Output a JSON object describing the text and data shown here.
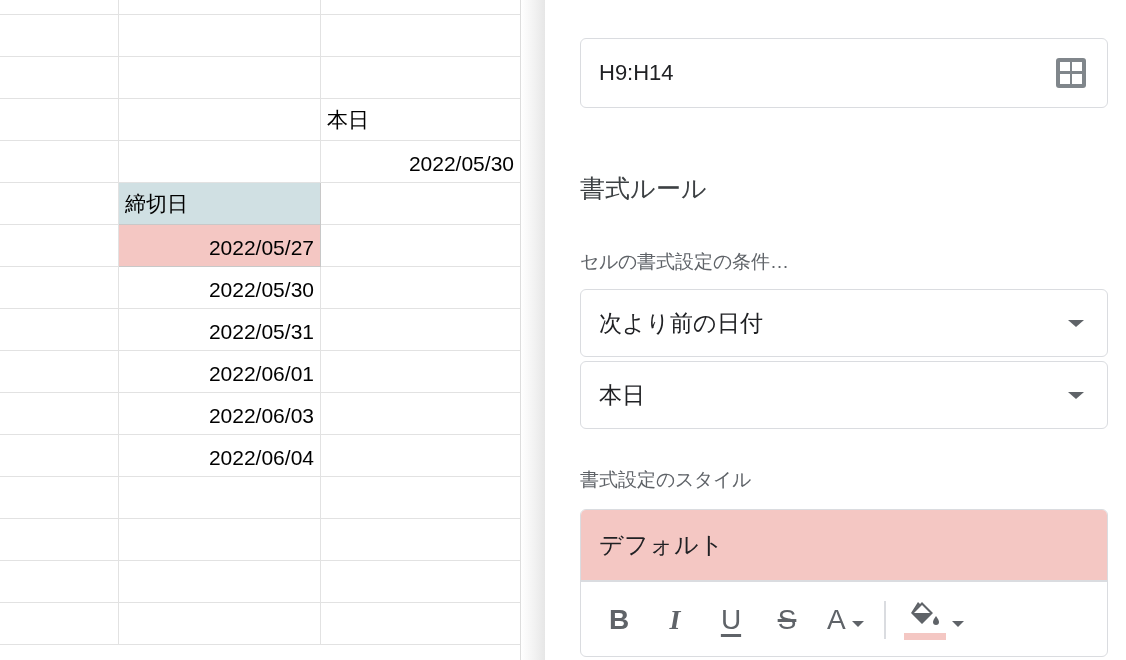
{
  "sheet": {
    "rows": [
      {},
      {},
      {},
      {
        "column_3": {
          "text": "本日",
          "kind": "text"
        }
      },
      {
        "column_3": {
          "text": "2022/05/30",
          "kind": "date"
        }
      },
      {
        "column_2": {
          "text": "締切日",
          "kind": "text",
          "color": "#d0e0e3"
        }
      },
      {
        "column_2": {
          "text": "2022/05/27",
          "kind": "date",
          "color": "#f4c7c3"
        }
      },
      {
        "column_2": {
          "text": "2022/05/30",
          "kind": "date"
        }
      },
      {
        "column_2": {
          "text": "2022/05/31",
          "kind": "date"
        }
      },
      {
        "column_2": {
          "text": "2022/06/01",
          "kind": "date"
        }
      },
      {
        "column_2": {
          "text": "2022/06/03",
          "kind": "date"
        }
      },
      {
        "column_2": {
          "text": "2022/06/04",
          "kind": "date"
        }
      },
      {},
      {},
      {},
      {}
    ]
  },
  "panel": {
    "range": {
      "value": "H9:H14"
    },
    "heading": "書式ルール",
    "condition_label": "セルの書式設定の条件…",
    "condition": {
      "value": "次より前の日付"
    },
    "condition_value": {
      "value": "本日"
    },
    "style_label": "書式設定のスタイル",
    "style": {
      "preview": "デフォルト",
      "color": "#f4c7c3",
      "toolbar": [
        {
          "kind": "bold",
          "label": "B"
        },
        {
          "kind": "italic",
          "label": "I"
        },
        {
          "kind": "underline",
          "label": "U"
        },
        {
          "kind": "strike",
          "label": "S"
        },
        {
          "kind": "text_color",
          "label": "A"
        },
        {
          "kind": "fill",
          "color": "#f4c7c3"
        }
      ]
    }
  }
}
